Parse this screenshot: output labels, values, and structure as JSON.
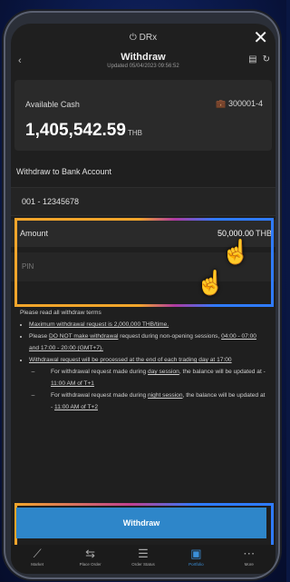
{
  "app": {
    "brand": "DRx"
  },
  "header": {
    "title": "Withdraw",
    "updated": "Updated 05/04/2023 09:56:52"
  },
  "cash": {
    "label": "Available Cash",
    "account": "300001-4",
    "amount": "1,405,542.59",
    "currency": "THB"
  },
  "bank": {
    "section_title": "Withdraw to Bank Account",
    "account": "001 - 12345678"
  },
  "amount": {
    "label": "Amount",
    "value": "50,000.00",
    "currency": "THB"
  },
  "pin": {
    "placeholder": "PIN"
  },
  "terms": {
    "heading": "Please read all withdraw terms",
    "b1": "Maximum withdrawal request is 2,000,000 THB/time.",
    "b2a": "Please ",
    "b2b": "DO NOT make withdrawal",
    "b2c": " request during non-opening sessions, ",
    "b2d": "04:00 - 07:00 and 17:00 - 20:00 (GMT+7).",
    "b3": "Withdrawal request will be processed at the end of each trading day at 17:00",
    "s1a": "For withdrawal request made during ",
    "s1b": "day session",
    "s1c": ", the balance will be updated at - ",
    "s1d": "11:00 AM of T+1",
    "s2a": "For withdrawal request made during ",
    "s2b": "night session",
    "s2c": ", the balance will be updated at - ",
    "s2d": "11:00 AM of T+2"
  },
  "action": {
    "withdraw_label": "Withdraw"
  },
  "tabs": [
    {
      "label": "Market",
      "icon": "chart-icon"
    },
    {
      "label": "Place Order",
      "icon": "transfer-icon"
    },
    {
      "label": "Order Status",
      "icon": "list-icon"
    },
    {
      "label": "Portfolio",
      "icon": "portfolio-icon"
    },
    {
      "label": "More",
      "icon": "more-icon"
    }
  ],
  "colors": {
    "accent": "#2e86c9",
    "highlight_orange": "#f2a52b",
    "highlight_blue": "#2f7bff"
  }
}
